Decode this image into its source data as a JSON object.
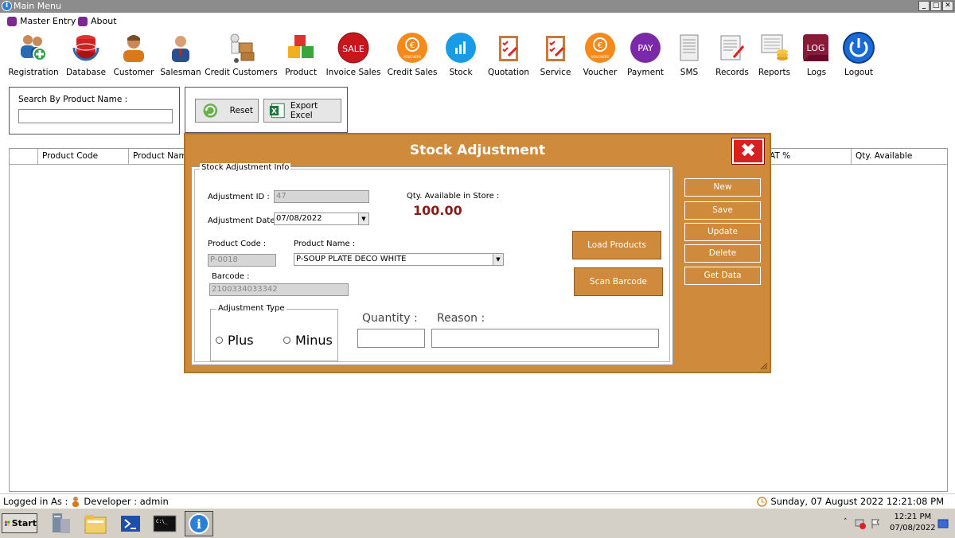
{
  "window": {
    "title": "Main Menu",
    "controls": [
      "_",
      "□",
      "✕"
    ]
  },
  "menu": [
    {
      "label": "Master Entry",
      "icon": "master-entry-icon"
    },
    {
      "label": "About",
      "icon": "about-icon"
    }
  ],
  "toolbar": [
    {
      "label": "Registration",
      "icon": "registration-icon"
    },
    {
      "label": "Database",
      "icon": "database-icon"
    },
    {
      "label": "Customer",
      "icon": "customer-icon"
    },
    {
      "label": "Salesman",
      "icon": "salesman-icon"
    },
    {
      "label": "Credit Customers",
      "icon": "credit-customers-icon"
    },
    {
      "label": "Product",
      "icon": "product-icon"
    },
    {
      "label": "Invoice Sales",
      "icon": "invoice-sales-icon",
      "badge": "SALE"
    },
    {
      "label": "Credit Sales",
      "icon": "credit-sales-icon",
      "badge": "VOUCHERS"
    },
    {
      "label": "Stock",
      "icon": "stock-icon"
    },
    {
      "label": "Quotation",
      "icon": "quotation-icon"
    },
    {
      "label": "Service",
      "icon": "service-icon"
    },
    {
      "label": "Voucher",
      "icon": "voucher-icon",
      "badge": "VOUCHERS"
    },
    {
      "label": "Payment",
      "icon": "payment-icon",
      "badge": "PAY"
    },
    {
      "label": "SMS",
      "icon": "sms-icon"
    },
    {
      "label": "Records",
      "icon": "records-icon"
    },
    {
      "label": "Reports",
      "icon": "reports-icon"
    },
    {
      "label": "Logs",
      "icon": "logs-icon",
      "badge": "LOG"
    },
    {
      "label": "Logout",
      "icon": "logout-icon"
    }
  ],
  "search": {
    "label": "Search By Product Name :",
    "value": "",
    "placeholder": ""
  },
  "actions": {
    "reset": "Reset",
    "export": "Export Excel"
  },
  "grid": {
    "columns": [
      "Product Code",
      "Product Nam",
      "AT %",
      "Qty. Available"
    ]
  },
  "modal": {
    "title": "Stock Adjustment",
    "close_label": "✖",
    "panel_caption": "Stock Adjustment Info",
    "adjustment_id_label": "Adjustment ID :",
    "adjustment_id": "47",
    "adjustment_date_label": "Adjustment Date :",
    "adjustment_date": "07/08/2022",
    "qty_label": "Qty. Available in Store :",
    "qty_value": "100.00",
    "product_code_label": "Product Code :",
    "product_code": "P-0018",
    "product_name_label": "Product Name :",
    "product_name": "P-SOUP PLATE DECO WHITE",
    "barcode_label": "Barcode :",
    "barcode": "2100334033342",
    "load_products": "Load Products",
    "scan_barcode": "Scan Barcode",
    "adjustment_type_label": "Adjustment Type",
    "plus": "Plus",
    "minus": "Minus",
    "quantity_label": "Quantity :",
    "quantity": "",
    "reason_label": "Reason :",
    "reason": "",
    "side_buttons": [
      "New",
      "Save",
      "Update",
      "Delete",
      "Get Data"
    ]
  },
  "status": {
    "logged_in": "Logged in As :",
    "user": "Developer : admin",
    "datetime": "Sunday, 07 August 2022 12:21:08 PM"
  },
  "taskbar": {
    "start": "Start",
    "time": "12:21 PM",
    "date": "07/08/2022"
  },
  "colors": {
    "modal": "#d08a3c",
    "qty": "#8b1a1a",
    "titlebar": "#8c8c8c"
  }
}
